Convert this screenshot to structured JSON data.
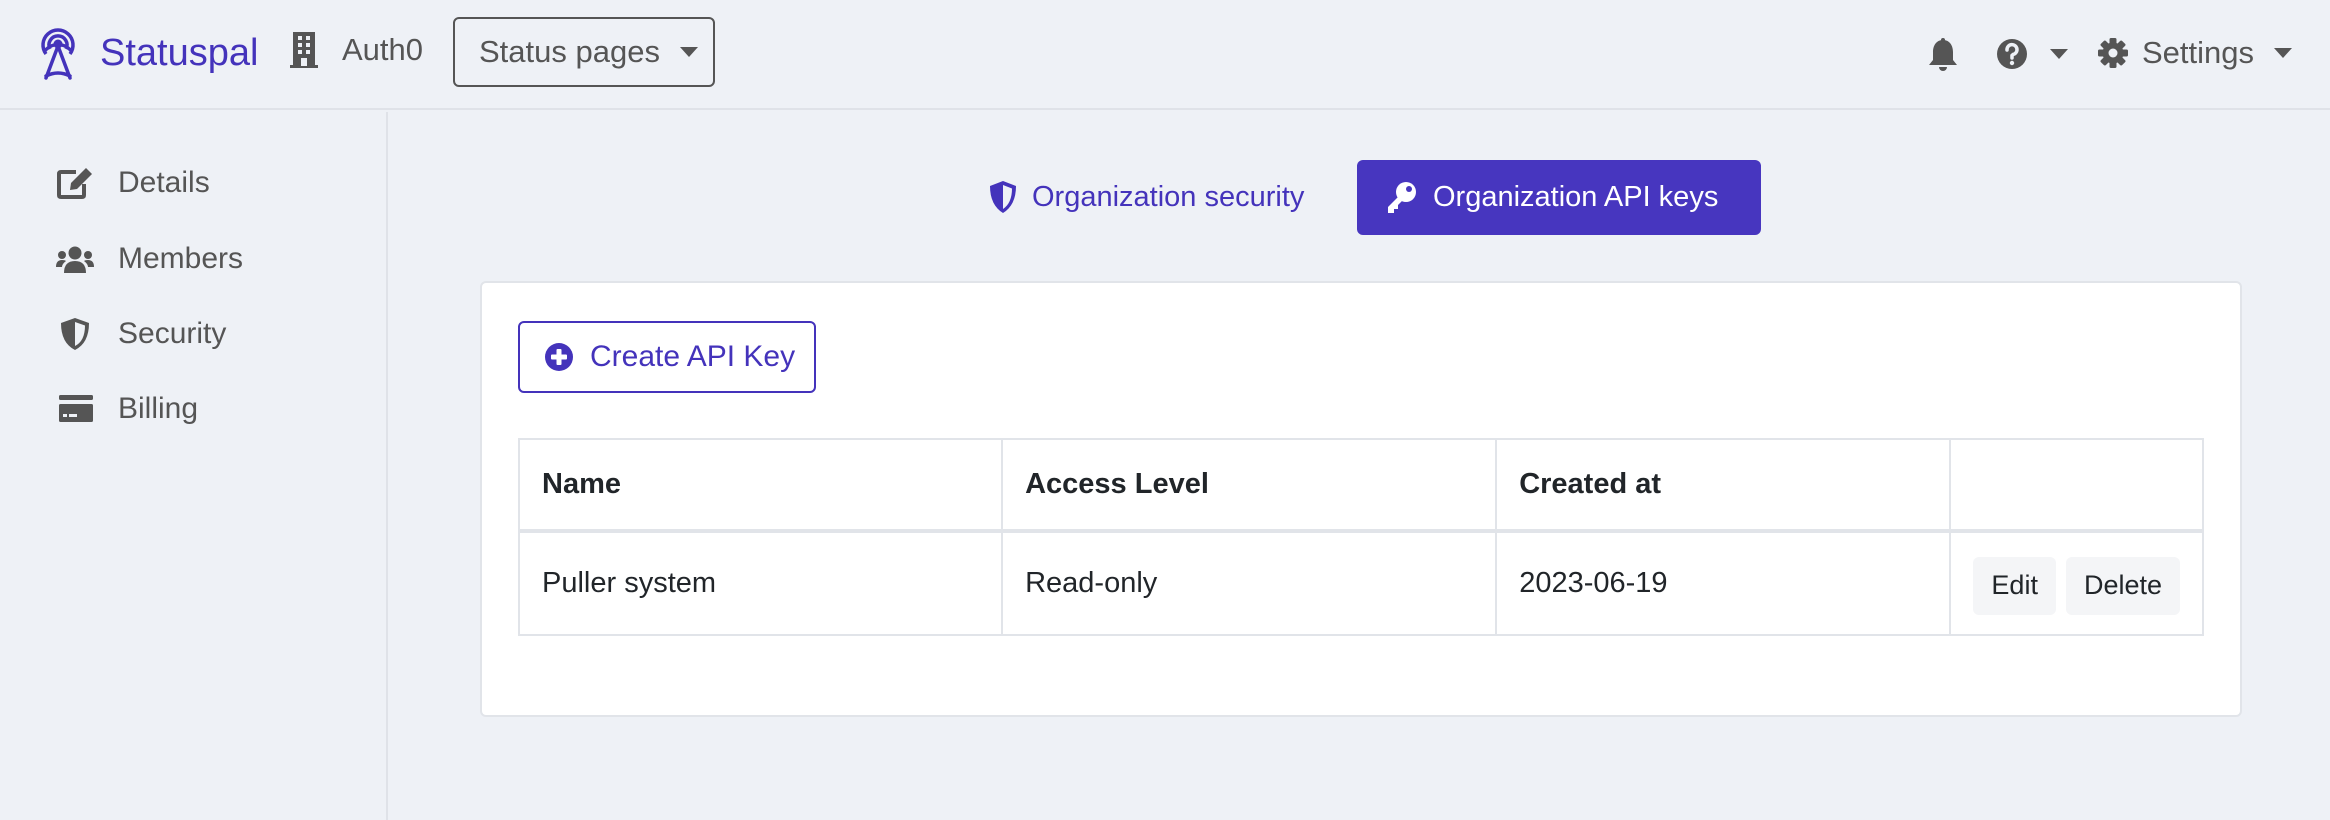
{
  "header": {
    "brand": "Statuspal",
    "organization": "Auth0",
    "status_pages_label": "Status pages",
    "settings_label": "Settings",
    "icons": {
      "logo": "broadcast-tower-icon",
      "organization": "building-icon",
      "notifications": "bell-icon",
      "help": "question-circle-icon",
      "settings": "gear-icon"
    }
  },
  "sidebar": {
    "items": [
      {
        "label": "Details",
        "icon": "edit-icon"
      },
      {
        "label": "Members",
        "icon": "users-icon"
      },
      {
        "label": "Security",
        "icon": "shield-icon"
      },
      {
        "label": "Billing",
        "icon": "credit-card-icon"
      }
    ]
  },
  "tabs": [
    {
      "label": "Organization security",
      "icon": "shield-icon",
      "active": false
    },
    {
      "label": "Organization API keys",
      "icon": "key-icon",
      "active": true
    }
  ],
  "main": {
    "create_button_label": "Create API Key",
    "table": {
      "columns": [
        "Name",
        "Access Level",
        "Created at",
        ""
      ],
      "rows": [
        {
          "name": "Puller system",
          "access_level": "Read-only",
          "created_at": "2023-06-19",
          "actions": [
            "Edit",
            "Delete"
          ]
        }
      ]
    }
  },
  "colors": {
    "accent": "#4736bf",
    "background": "#eef1f6",
    "text": "#555555"
  }
}
